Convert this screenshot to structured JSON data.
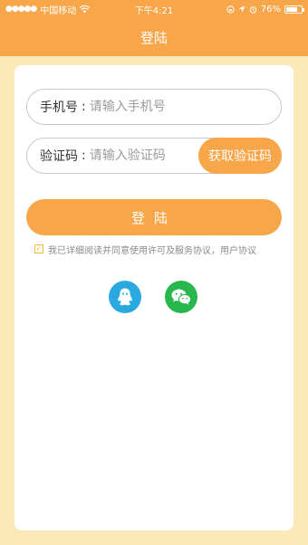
{
  "status_bar": {
    "signal": "●●●●●",
    "carrier": "中国移动",
    "wifi_icon": "wifi-icon",
    "time": "下午4:21",
    "battery_level": "76%"
  },
  "nav": {
    "title": "登陆"
  },
  "form": {
    "phone_label": "手机号",
    "phone_colon": ":",
    "phone_placeholder": "请输入手机号",
    "code_label": "验证码",
    "code_colon": ":",
    "code_placeholder": "请输入验证码",
    "get_code_button": "获取验证码",
    "login_button": "登陆",
    "agreement_text": "我已详细阅读并同意使用许可及服务协议，用户协议",
    "checkbox_checked": true
  },
  "social": {
    "qq_icon": "qq-icon",
    "wechat_icon": "wechat-icon"
  },
  "colors": {
    "accent": "#f8a64a",
    "background": "#fbe9b8",
    "qq": "#2aa9e0",
    "wechat": "#27b74c"
  }
}
